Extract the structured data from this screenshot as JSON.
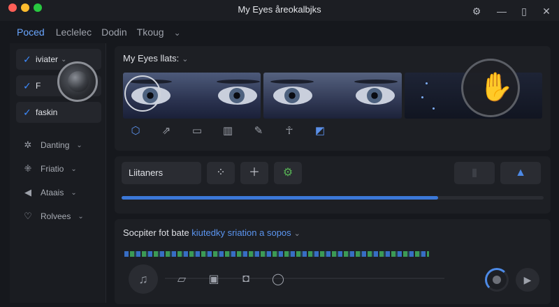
{
  "window": {
    "title": "My Eyes åreokalbjks"
  },
  "tabs": [
    {
      "label": "Poced",
      "active": true
    },
    {
      "label": "Leclelec",
      "active": false
    },
    {
      "label": "Dodin",
      "active": false
    },
    {
      "label": "Tkoug",
      "active": false
    }
  ],
  "sidebar": {
    "chips": [
      {
        "label": "iviater"
      },
      {
        "label": "F"
      },
      {
        "label": "faskin"
      }
    ],
    "items": [
      {
        "label": "Danting",
        "icon": "sparkle-icon"
      },
      {
        "label": "Friatio",
        "icon": "grid-icon"
      },
      {
        "label": "Ataais",
        "icon": "megaphone-icon"
      },
      {
        "label": "Rolvees",
        "icon": "heart-icon"
      }
    ]
  },
  "gallery": {
    "title": "My Eyes llats:",
    "tools": [
      "hexagon-plus-icon",
      "share-icon",
      "comment-icon",
      "book-icon",
      "pencil-icon",
      "figure-icon",
      "chat-bubble-icon"
    ]
  },
  "listeners": {
    "field_value": "Liitaners",
    "progress": 0.75
  },
  "subtitle": {
    "prefix": "Socpiter fot bate",
    "accent": "kiutedky sriation a sopos"
  },
  "colors": {
    "accent": "#4c8dff",
    "green": "#56b054"
  }
}
